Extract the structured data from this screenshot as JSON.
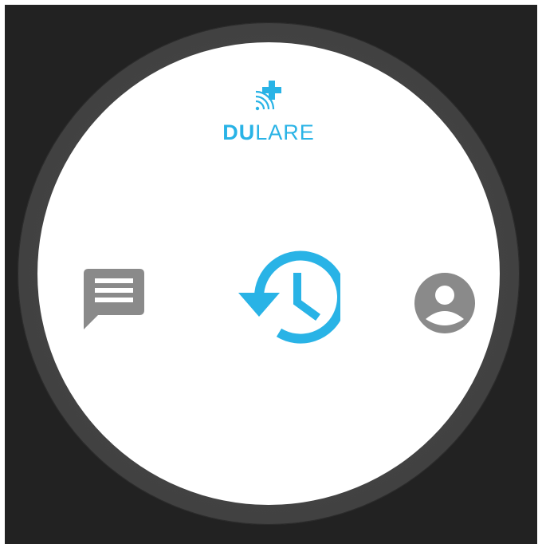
{
  "app": {
    "brand_bold": "DU",
    "brand_light": "LARE"
  },
  "icons": {
    "logo": "medical-cross-signal-icon",
    "left": "chat-message-icon",
    "center": "history-icon",
    "right": "account-profile-icon"
  },
  "colors": {
    "accent": "#29b3e6",
    "icon_gray": "#8a8a8a",
    "bezel": "#414141",
    "background": "#222222"
  }
}
